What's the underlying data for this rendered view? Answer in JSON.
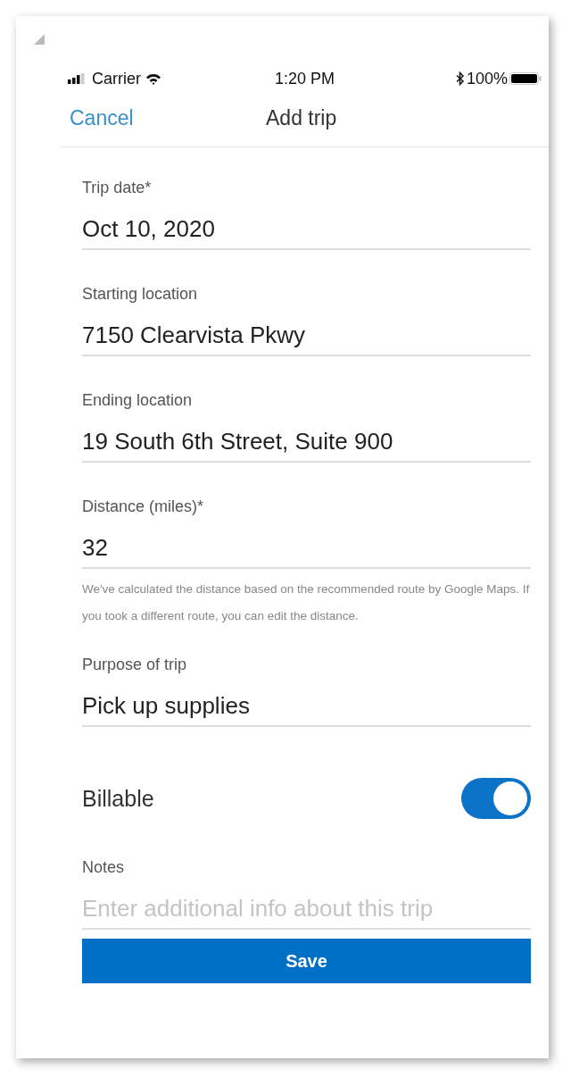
{
  "status_bar": {
    "carrier": "Carrier",
    "time": "1:20 PM",
    "battery": "100%"
  },
  "nav": {
    "cancel": "Cancel",
    "title": "Add trip"
  },
  "fields": [
    {
      "kind": "input",
      "label": "Trip date*",
      "value": "Oct 10, 2020"
    },
    {
      "kind": "input",
      "label": "Starting location",
      "value": "7150 Clearvista Pkwy"
    },
    {
      "kind": "input",
      "label": "Ending location",
      "value": "19 South 6th Street, Suite 900"
    },
    {
      "kind": "input",
      "label": "Distance (miles)*",
      "value": "32",
      "help": "We've calculated the distance based on the recommended route by Google Maps. If you took a different route, you can edit the distance."
    },
    {
      "kind": "input",
      "label": "Purpose of trip",
      "value": "Pick up supplies"
    },
    {
      "kind": "toggle",
      "label": "Billable",
      "on": true
    },
    {
      "kind": "input",
      "label": "Notes",
      "placeholder": "Enter additional info about this trip"
    }
  ],
  "save": "Save"
}
